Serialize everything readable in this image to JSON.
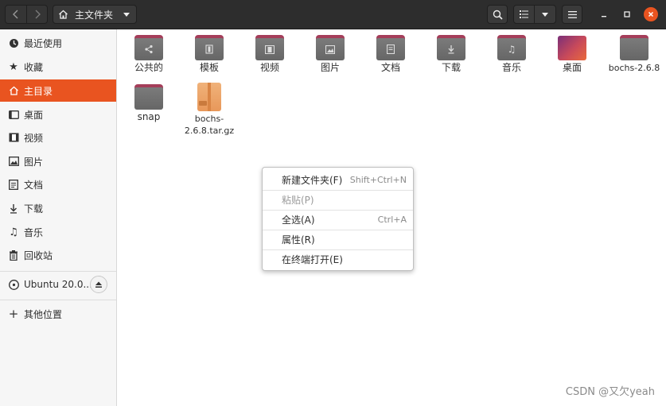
{
  "window": {
    "path_button": "主文件夹",
    "icons": {
      "back": "chevron-left-icon",
      "forward": "chevron-right-icon",
      "home": "home-icon",
      "search": "search-icon",
      "view": "list-view-icon",
      "menu": "hamburger-menu-icon"
    },
    "close_color": "#e95420"
  },
  "sidebar": {
    "items": [
      {
        "label": "最近使用",
        "icon": "clock-icon"
      },
      {
        "label": "收藏",
        "icon": "star-icon"
      },
      {
        "label": "主目录",
        "icon": "home-icon",
        "active": true
      },
      {
        "label": "桌面",
        "icon": "desktop-icon"
      },
      {
        "label": "视频",
        "icon": "film-icon"
      },
      {
        "label": "图片",
        "icon": "image-icon"
      },
      {
        "label": "文档",
        "icon": "document-icon"
      },
      {
        "label": "下载",
        "icon": "download-icon"
      },
      {
        "label": "音乐",
        "icon": "music-icon"
      },
      {
        "label": "回收站",
        "icon": "trash-icon"
      }
    ],
    "volume": {
      "label": "Ubuntu 20.0...",
      "icon": "disc-icon"
    },
    "other_locations": {
      "label": "其他位置",
      "icon": "plus-icon"
    }
  },
  "files": [
    {
      "name": "公共的",
      "kind": "folder",
      "emblem": "share-icon"
    },
    {
      "name": "模板",
      "kind": "folder",
      "emblem": "template-icon"
    },
    {
      "name": "视频",
      "kind": "folder",
      "emblem": "film-icon"
    },
    {
      "name": "图片",
      "kind": "folder",
      "emblem": "image-icon"
    },
    {
      "name": "文档",
      "kind": "folder",
      "emblem": "document-icon"
    },
    {
      "name": "下载",
      "kind": "folder",
      "emblem": "download-icon"
    },
    {
      "name": "音乐",
      "kind": "folder",
      "emblem": "music-icon"
    },
    {
      "name": "桌面",
      "kind": "desktop-folder"
    },
    {
      "name": "bochs-2.6.8",
      "kind": "folder"
    },
    {
      "name": "snap",
      "kind": "folder"
    },
    {
      "name": "bochs-\n2.6.8.tar.gz",
      "kind": "archive",
      "icon": "archive-icon"
    }
  ],
  "context_menu": {
    "items": [
      {
        "label": "新建文件夹(F)",
        "accel": "Shift+Ctrl+N",
        "enabled": true
      },
      {
        "label": "粘贴(P)",
        "accel": "",
        "enabled": false
      },
      {
        "label": "全选(A)",
        "accel": "Ctrl+A",
        "enabled": true
      },
      {
        "label": "属性(R)",
        "accel": "",
        "enabled": true
      },
      {
        "label": "在终端打开(E)",
        "accel": "",
        "enabled": true
      }
    ]
  },
  "watermark": "CSDN @又欠yeah",
  "colors": {
    "accent": "#e95420",
    "folder_tab": "#a53e5a"
  }
}
